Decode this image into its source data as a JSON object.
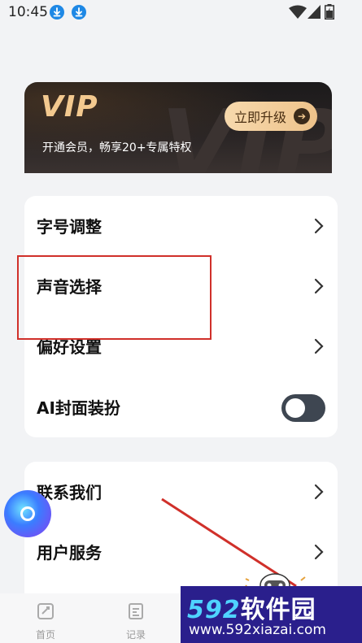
{
  "status_bar": {
    "time": "10:45",
    "notification_icons": [
      "download-icon",
      "download-icon"
    ],
    "system_icons": [
      "wifi-icon",
      "signal-icon",
      "battery-icon"
    ]
  },
  "vip": {
    "title": "VIP",
    "subtitle": "开通会员，畅享20+专属特权",
    "upgrade_label": "立即升级",
    "background_text": "VIP",
    "accent_color": "#f3c98f"
  },
  "settings": {
    "group1": [
      {
        "label": "字号调整",
        "type": "link"
      },
      {
        "label": "声音选择",
        "type": "link"
      },
      {
        "label": "偏好设置",
        "type": "link"
      },
      {
        "label": "AI封面装扮",
        "type": "toggle",
        "value": "off"
      }
    ],
    "group2": [
      {
        "label": "联系我们",
        "type": "link"
      },
      {
        "label": "用户服务",
        "type": "link"
      }
    ]
  },
  "bottom_nav": [
    {
      "label": "首页",
      "icon": "home-icon"
    },
    {
      "label": "记录",
      "icon": "records-icon"
    }
  ],
  "watermark": {
    "brand_number": "592",
    "brand_text": "软件园",
    "url": "www.592xiazai.com"
  },
  "annotation_color": "#d0302a"
}
